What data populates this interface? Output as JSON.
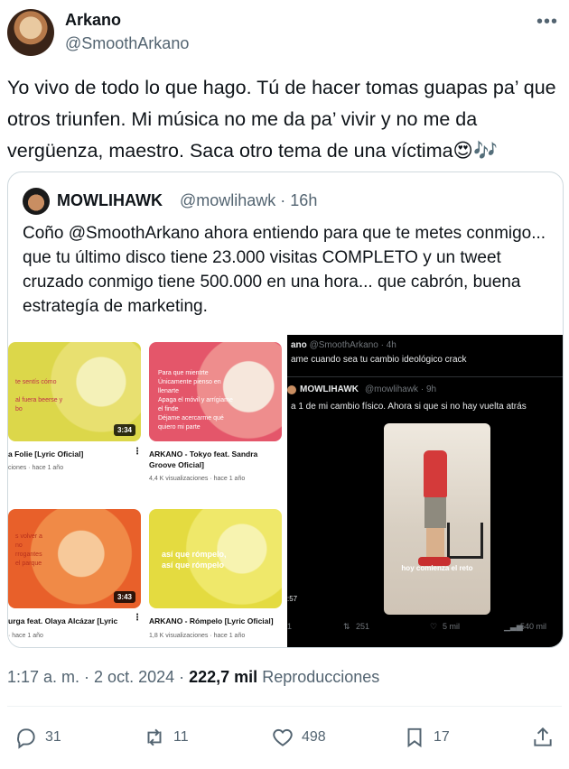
{
  "author": {
    "name": "Arkano",
    "handle": "@SmoothArkano"
  },
  "tweet": {
    "text": "Yo vivo de todo lo que hago. Tú de hacer tomas guapas pa’ que otros triunfen. Mi música no me da pa’ vivir y no me da vergüenza, maestro. Saca otro tema de una víctima😍🎶"
  },
  "quote": {
    "name": "MOWLIHAWK",
    "handle": "@mowlihawk · 16h",
    "text": "Coño @SmoothArkano ahora entiendo para que te metes conmigo... que tu último disco tiene 23.000 visitas COMPLETO y un tweet cruzado conmigo tiene 500.000 en una hora... que cabrón, buena estrategía de marketing.",
    "left_media": {
      "videos": [
        {
          "title": "a Folie [Lyric Oficial]",
          "meta": "ciones · hace 1 año",
          "duration": "3:34",
          "overlay": "te sentís cómo\n\nal fuera beerse y\nbo"
        },
        {
          "title": "ARKANO - Tokyo feat. Sandra Groove Oficial]",
          "meta": "4,4 K visualizaciones · hace 1 año",
          "duration": "",
          "overlay": "Para que mientrte\nÚnicamente pienso en\nllenarte\nApaga el móvil y arrígiame\nel finde\nDéjame acercarme qué\nquiero mi parte"
        },
        {
          "title": "urga feat. Olaya Alcázar [Lyric",
          "meta": "· hace 1 año",
          "duration": "3:43",
          "overlay": "s volver a\nno\nrrogantes\nel parque"
        },
        {
          "title": "ARKANO - Rómpelo [Lyric Oficial]",
          "meta": "1,8 K visualizaciones · hace 1 año",
          "duration": "",
          "overlay": "así que rómpelo,\nasí que rómpelo"
        }
      ]
    },
    "right_media": {
      "top_handle": "@SmoothArkano · 4h",
      "top_name": "ano",
      "top_text": "ame cuando sea tu cambio ideológico crack",
      "inner_name": "MOWLIHAWK",
      "inner_handle": "@mowlihawk · 9h",
      "inner_text": "a 1 de mi cambio físico. Ahora si que si no hay vuelta atrás",
      "video_caption": "hoy comienza el reto",
      "video_time": ":57",
      "stats": {
        "replies": "1",
        "retweets": "251",
        "likes": "5 mil",
        "views": "540 mil"
      }
    }
  },
  "meta": {
    "time": "1:17 a. m.",
    "date": "2 oct. 2024",
    "views_count": "222,7 mil",
    "views_label": "Reproducciones"
  },
  "actions": {
    "replies": "31",
    "retweets": "11",
    "likes": "498",
    "bookmarks": "17"
  }
}
